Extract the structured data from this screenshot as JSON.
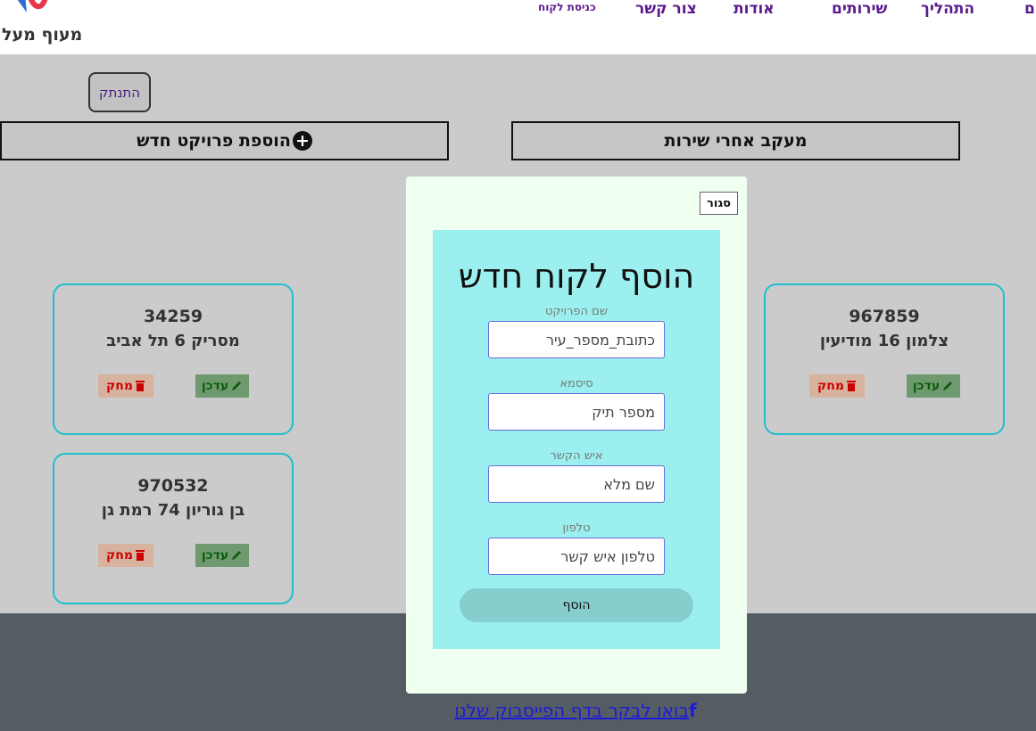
{
  "header": {
    "brand": "מעוף מעל",
    "nav": {
      "edge": "ם",
      "process": "התהליך",
      "services": "שירותים",
      "about": "אודות",
      "contact": "צור קשר",
      "client_login": "כניסת לקוח"
    }
  },
  "actions": {
    "logout": "התנתק",
    "add_project": "הוספת פרויקט חדש",
    "service_tracking": "מעקב אחרי שירות"
  },
  "projects": [
    {
      "number": "34259",
      "address": "מסריק 6 תל אביב",
      "edit_label": "עדכן",
      "delete_label": "מחק"
    },
    {
      "number": "970532",
      "address": "בן גוריון 74 רמת גן",
      "edit_label": "עדכן",
      "delete_label": "מחק"
    },
    {
      "number": "967859",
      "address": "צלמון 16 מודיעין",
      "edit_label": "עדכן",
      "delete_label": "מחק"
    }
  ],
  "modal": {
    "close_label": "סגור",
    "title": "הוסף לקוח חדש",
    "fields": [
      {
        "label": "שם הפרויקט",
        "placeholder": "כתובת_מספר_עיר"
      },
      {
        "label": "סיסמא",
        "placeholder": "מספר תיק"
      },
      {
        "label": "איש הקשר",
        "placeholder": "שם מלא"
      },
      {
        "label": "טלפון",
        "placeholder": "טלפון איש קשר"
      }
    ],
    "submit_label": "הוסף"
  },
  "footer": {
    "facebook_link": "בואו לבקר בדף הפייסבוק שלנו"
  },
  "colors": {
    "nav_purple": "#5a1a8e",
    "card_border": "#1fbfcf",
    "form_bg": "#9bf0ef",
    "edit_bg": "#6f9a6f",
    "delete_bg": "#d7b39f",
    "footer_bg": "#565c63"
  },
  "icons": {
    "plus": "plus-circle-icon",
    "edit": "pencil-icon",
    "delete": "trash-icon",
    "facebook": "facebook-icon"
  }
}
